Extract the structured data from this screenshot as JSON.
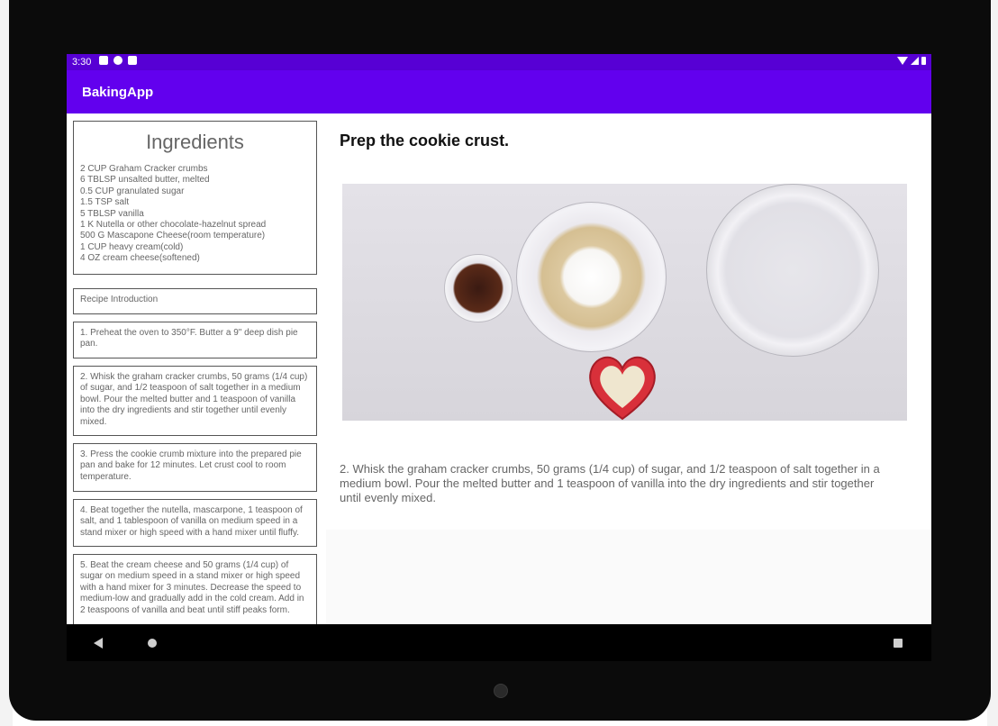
{
  "status_bar": {
    "time": "3:30",
    "icons": [
      "notification-a-icon",
      "notification-p-icon",
      "sd-card-icon"
    ],
    "right_icons": [
      "wifi-icon",
      "signal-icon",
      "battery-icon"
    ]
  },
  "app_bar": {
    "title": "BakingApp",
    "color": "#6200ee",
    "status_color": "#5700d4"
  },
  "ingredients": {
    "title": "Ingredients",
    "items": [
      "2 CUP Graham Cracker crumbs",
      "6 TBLSP unsalted butter, melted",
      "0.5 CUP granulated sugar",
      "1.5 TSP salt",
      "5 TBLSP vanilla",
      "1 K Nutella or other chocolate-hazelnut spread",
      "500 G Mascapone Cheese(room temperature)",
      "1 CUP heavy cream(cold)",
      "4 OZ cream cheese(softened)"
    ]
  },
  "steps": [
    "Recipe Introduction",
    "1. Preheat the oven to 350°F. Butter a 9\" deep dish pie pan.",
    "2. Whisk the graham cracker crumbs, 50 grams (1/4 cup) of sugar, and 1/2 teaspoon of salt together in a medium bowl. Pour the melted butter and 1 teaspoon of vanilla into the dry ingredients and stir together until evenly mixed.",
    "3. Press the cookie crumb mixture into the prepared pie pan and bake for 12 minutes. Let crust cool to room temperature.",
    "4. Beat together the nutella, mascarpone, 1 teaspoon of salt, and 1 tablespoon of vanilla on medium speed in a stand mixer or high speed with a hand mixer until fluffy.",
    "5. Beat the cream cheese and 50 grams (1/4 cup) of sugar on medium speed in a stand mixer or high speed with a hand mixer for 3 minutes. Decrease the speed to medium-low and gradually add in the cold cream. Add in 2 teaspoons of vanilla and beat until stiff peaks form."
  ],
  "detail": {
    "heading": "Prep the cookie crust.",
    "description": "2. Whisk the graham cracker crumbs, 50 grams (1/4 cup) of sugar, and 1/2 teaspoon of salt together in a medium bowl. Pour the melted butter and 1 teaspoon of vanilla into the dry ingredients and stir together until evenly mixed."
  },
  "nav_bar": {
    "buttons": [
      "back-icon",
      "home-icon",
      "recents-icon"
    ]
  }
}
